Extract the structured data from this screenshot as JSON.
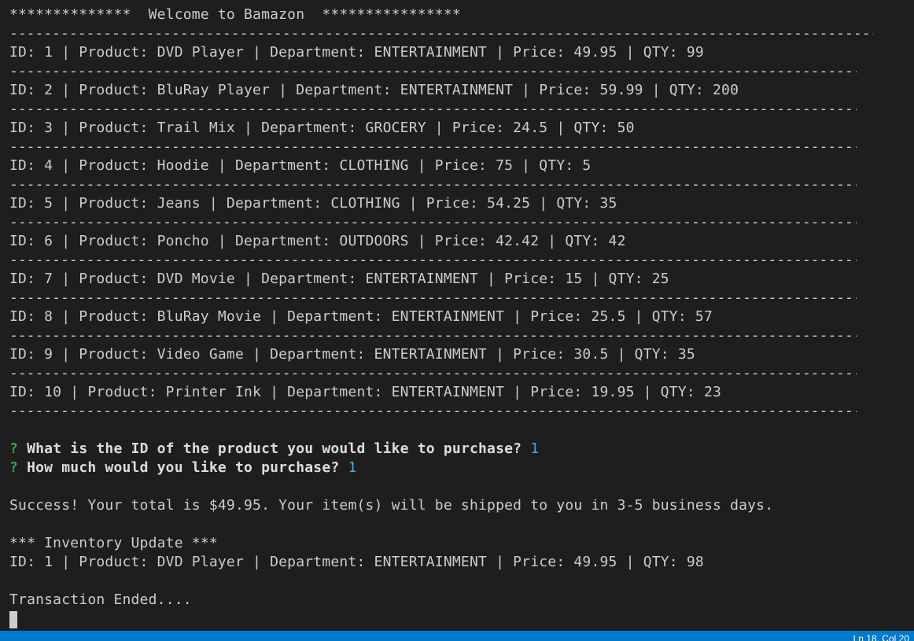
{
  "terminal": {
    "header": "**************  Welcome to Bamazon  ****************",
    "separator": "-----------------------------------------------------------------------------------------------------------------",
    "products": [
      "ID: 1 | Product: DVD Player | Department: ENTERTAINMENT | Price: 49.95 | QTY: 99",
      "ID: 2 | Product: BluRay Player | Department: ENTERTAINMENT | Price: 59.99 | QTY: 200",
      "ID: 3 | Product: Trail Mix | Department: GROCERY | Price: 24.5 | QTY: 50",
      "ID: 4 | Product: Hoodie | Department: CLOTHING | Price: 75 | QTY: 5",
      "ID: 5 | Product: Jeans | Department: CLOTHING | Price: 54.25 | QTY: 35",
      "ID: 6 | Product: Poncho | Department: OUTDOORS | Price: 42.42 | QTY: 42",
      "ID: 7 | Product: DVD Movie | Department: ENTERTAINMENT | Price: 15 | QTY: 25",
      "ID: 8 | Product: BluRay Movie | Department: ENTERTAINMENT | Price: 25.5 | QTY: 57",
      "ID: 9 | Product: Video Game | Department: ENTERTAINMENT | Price: 30.5 | QTY: 35",
      "ID: 10 | Product: Printer Ink | Department: ENTERTAINMENT | Price: 19.95 | QTY: 23"
    ],
    "prompt_mark": "?",
    "prompts": [
      {
        "question": "What is the ID of the product you would like to purchase?",
        "answer": "1"
      },
      {
        "question": "How much would you like to purchase?",
        "answer": "1"
      }
    ],
    "success_message": "Success! Your total is $49.95. Your item(s) will be shipped to you in 3-5 business days.",
    "inventory_header": "*** Inventory Update ***",
    "inventory_line": "ID: 1 | Product: DVD Player | Department: ENTERTAINMENT | Price: 49.95 | QTY: 98",
    "ended_message": "Transaction Ended...."
  },
  "statusbar": {
    "position": "Ln 18, Col 20"
  },
  "colors": {
    "background": "#1e1e1e",
    "text": "#cccccc",
    "prompt_mark": "#2fa84f",
    "answer": "#29b8db",
    "statusbar": "#007acc"
  }
}
